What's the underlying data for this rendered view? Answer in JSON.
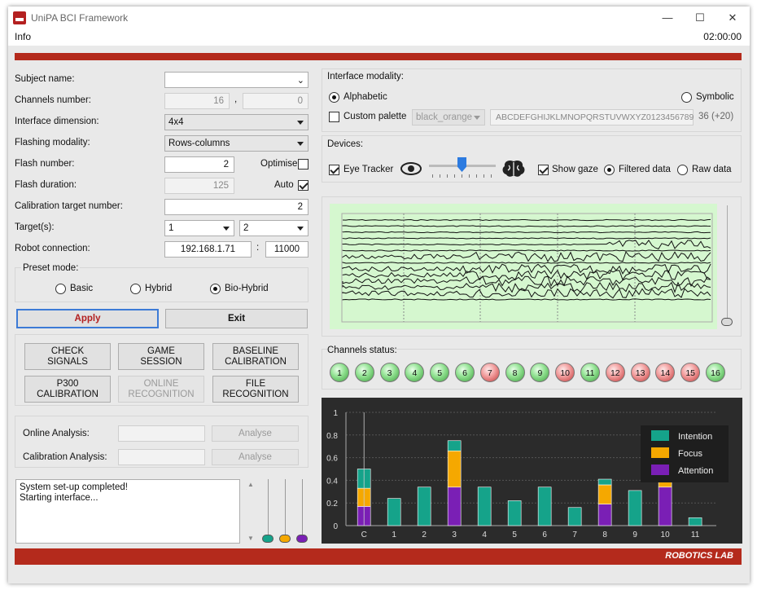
{
  "window": {
    "title": "UniPA BCI Framework",
    "minimize": "—",
    "maximize": "☐",
    "close": "✕"
  },
  "menu": {
    "info": "Info",
    "clock": "02:00:00"
  },
  "form": {
    "subject_label": "Subject name:",
    "subject_value": "",
    "channels_label": "Channels number:",
    "channels_a": "16",
    "channels_sep": ",",
    "channels_b": "0",
    "iface_dim_label": "Interface dimension:",
    "iface_dim_value": "4x4",
    "flash_mod_label": "Flashing modality:",
    "flash_mod_value": "Rows-columns",
    "flash_num_label": "Flash number:",
    "flash_num_value": "2",
    "optimise_label": "Optimise",
    "optimise_checked": false,
    "flash_dur_label": "Flash duration:",
    "flash_dur_value": "125",
    "auto_label": "Auto",
    "auto_checked": true,
    "calib_target_label": "Calibration target number:",
    "calib_target_value": "2",
    "targets_label": "Target(s):",
    "target1": "1",
    "target2": "2",
    "robot_label": "Robot connection:",
    "robot_ip": "192.168.1.71",
    "robot_sep": ":",
    "robot_port": "11000"
  },
  "preset": {
    "title": "Preset mode:",
    "options": [
      "Basic",
      "Hybrid",
      "Bio-Hybrid"
    ],
    "selected": "Bio-Hybrid"
  },
  "actions": {
    "apply": "Apply",
    "exit": "Exit"
  },
  "sessions": [
    {
      "label": "CHECK\nSIGNALS",
      "enabled": true
    },
    {
      "label": "GAME\nSESSION",
      "enabled": true
    },
    {
      "label": "BASELINE\nCALIBRATION",
      "enabled": true
    },
    {
      "label": "P300\nCALIBRATION",
      "enabled": true
    },
    {
      "label": "ONLINE\nRECOGNITION",
      "enabled": false
    },
    {
      "label": "FILE\nRECOGNITION",
      "enabled": true
    }
  ],
  "analysis": {
    "online_label": "Online Analysis:",
    "calib_label": "Calibration Analysis:",
    "analyse": "Analyse"
  },
  "log": {
    "lines": [
      "System set-up completed!",
      "Starting interface..."
    ]
  },
  "color_sliders": {
    "colors": [
      "#15a38a",
      "#f5a800",
      "#7a1fb5"
    ]
  },
  "interface_modality": {
    "title": "Interface modality:",
    "alphabetic": "Alphabetic",
    "symbolic": "Symbolic",
    "selected": "Alphabetic",
    "custom_palette": "Custom palette",
    "palette_value": "black_orange",
    "alphabet": "ABCDEFGHIJKLMNOPQRSTUVWXYZ0123456789",
    "count": "36 (+20)"
  },
  "devices": {
    "title": "Devices:",
    "eye_tracker": "Eye Tracker",
    "eye_tracker_checked": true,
    "show_gaze": "Show gaze",
    "show_gaze_checked": true,
    "filtered": "Filtered data",
    "raw": "Raw data",
    "selected": "Filtered data",
    "eye_icon": "eye-icon",
    "brain_icon": "brain-icon"
  },
  "channels_status": {
    "title": "Channels status:",
    "channels": [
      {
        "n": "1",
        "s": "ok"
      },
      {
        "n": "2",
        "s": "ok"
      },
      {
        "n": "3",
        "s": "ok"
      },
      {
        "n": "4",
        "s": "ok"
      },
      {
        "n": "5",
        "s": "ok"
      },
      {
        "n": "6",
        "s": "ok"
      },
      {
        "n": "7",
        "s": "bad"
      },
      {
        "n": "8",
        "s": "ok"
      },
      {
        "n": "9",
        "s": "ok"
      },
      {
        "n": "10",
        "s": "bad"
      },
      {
        "n": "11",
        "s": "ok"
      },
      {
        "n": "12",
        "s": "bad"
      },
      {
        "n": "13",
        "s": "bad"
      },
      {
        "n": "14",
        "s": "bad"
      },
      {
        "n": "15",
        "s": "bad"
      },
      {
        "n": "16",
        "s": "ok"
      }
    ]
  },
  "footer": {
    "brand": "ROBOTICS LAB"
  },
  "chart_data": {
    "type": "bar",
    "stacked": true,
    "categories": [
      "C",
      "1",
      "2",
      "3",
      "4",
      "5",
      "6",
      "7",
      "8",
      "9",
      "10",
      "11"
    ],
    "series": [
      {
        "name": "Attention",
        "color": "#7a1fb5",
        "values": [
          0.17,
          0,
          0,
          0.34,
          0,
          0,
          0,
          0,
          0.19,
          0,
          0.34,
          0
        ]
      },
      {
        "name": "Focus",
        "color": "#f5a800",
        "values": [
          0.16,
          0,
          0,
          0.32,
          0,
          0,
          0,
          0,
          0.17,
          0,
          0.32,
          0
        ]
      },
      {
        "name": "Intention",
        "color": "#15a38a",
        "values": [
          0.17,
          0.24,
          0.34,
          0.09,
          0.34,
          0.22,
          0.34,
          0.16,
          0.05,
          0.31,
          0.08,
          0.07
        ]
      }
    ],
    "legend_order": [
      "Intention",
      "Focus",
      "Attention"
    ],
    "yticks": [
      "0",
      "0.2",
      "0.4",
      "0.6",
      "0.8",
      "1"
    ],
    "ylim": [
      0,
      1
    ],
    "legend": "top-right",
    "grid": true
  }
}
